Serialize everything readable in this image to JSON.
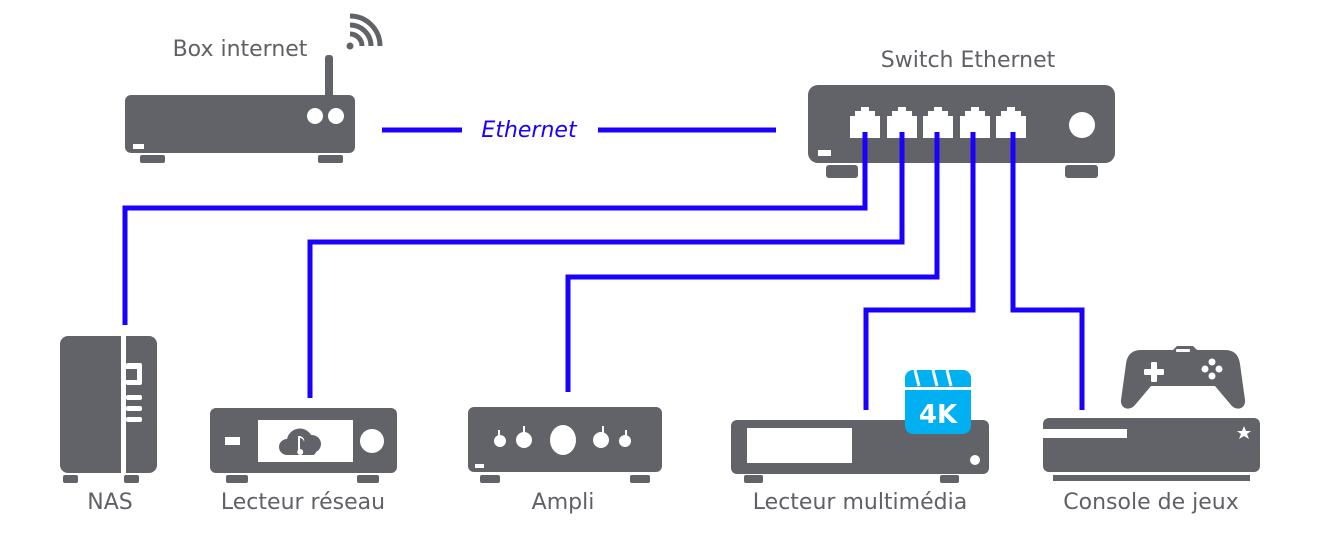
{
  "colors": {
    "device": "#616368",
    "cable": "#1a00ff",
    "badge": "#00b0f0",
    "label": "#5f6166"
  },
  "top": {
    "box_label": "Box internet",
    "switch_label": "Switch Ethernet",
    "link_label": "Ethernet",
    "icons": [
      "wifi-icon",
      "router-icon",
      "switch-icon"
    ]
  },
  "devices": [
    {
      "label": "NAS",
      "icon": "nas-icon"
    },
    {
      "label": "Lecteur réseau",
      "icon": "cloud-music-icon"
    },
    {
      "label": "Ampli",
      "icon": "amplifier-icon"
    },
    {
      "label": "Lecteur multimédia",
      "icon": "media-player-icon",
      "badge": "4K"
    },
    {
      "label": "Console de jeux",
      "icon": "gamepad-icon"
    }
  ]
}
